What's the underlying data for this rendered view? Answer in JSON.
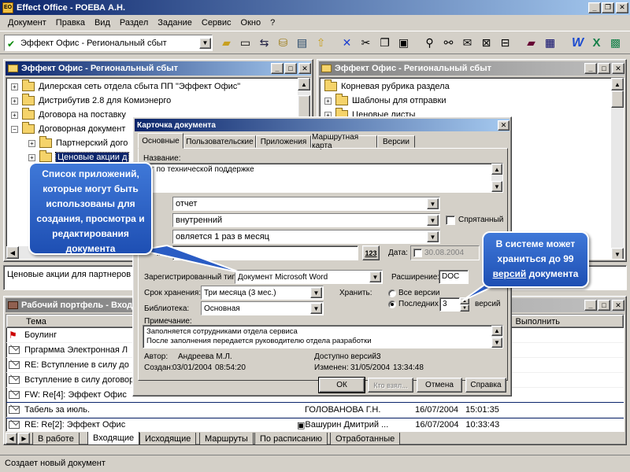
{
  "app": {
    "title": "Effect Office - РОЕВА А.Н.",
    "icon_label": "EO"
  },
  "menu": [
    "Документ",
    "Правка",
    "Вид",
    "Раздел",
    "Задание",
    "Сервис",
    "Окно",
    "?"
  ],
  "toolbar": {
    "combo_value": "Эффект Офис - Региональный сбыт"
  },
  "left_panel": {
    "title": "Эффект Офис - Региональный сбыт",
    "items": [
      {
        "label": "Дилерская сеть отдела сбыта ПП \"Эффект Офис\"",
        "level": 0
      },
      {
        "label": "Дистрибутив 2.8 для Комиэнерго",
        "level": 0
      },
      {
        "label": "Договора на поставку",
        "level": 0
      },
      {
        "label": "Договорная документ",
        "level": 0,
        "open": true
      },
      {
        "label": "Партнерский дого",
        "level": 1
      },
      {
        "label": "Ценовые акции д",
        "level": 1,
        "selected": true
      }
    ],
    "status": "Ценовые акции для партнеров"
  },
  "right_panel": {
    "title": "Эффект Офис - Региональный сбыт",
    "root": "Корневая рубрика раздела",
    "items": [
      "Шаблоны для отправки",
      "Ценовые листы"
    ]
  },
  "portfolio": {
    "title": "Рабочий портфель - Вход",
    "col_subject": "Тема",
    "col_perform": "Выполнить",
    "rows": [
      {
        "subject": "Боулинг",
        "author": "",
        "date": "",
        "time": "",
        "icon": "flag"
      },
      {
        "subject": "Пргармма Электронная Л",
        "author": "",
        "date": "",
        "time": "",
        "icon": "mail"
      },
      {
        "subject": "RE: Вступление в силу до",
        "author": "",
        "date": "",
        "time": "",
        "icon": "mail"
      },
      {
        "subject": "Вступление в силу договор",
        "author": "",
        "date": "",
        "time": "",
        "icon": "mail"
      },
      {
        "subject": "FW: Re[4]: Эффект Офис",
        "author": "",
        "date": "",
        "time": "",
        "icon": "mail"
      },
      {
        "subject": "Табель за июль.",
        "author": "ГОЛОВАНОВА Г.Н.",
        "date": "16/07/2004",
        "time": "15:01:35",
        "icon": "mail"
      },
      {
        "subject": "RE: Re[2]: Эффект Офис",
        "author": "Вашурин Дмитрий ...",
        "date": "16/07/2004",
        "time": "10:33:43",
        "icon": "mail"
      }
    ],
    "tabs": [
      "В работе",
      "Входящие",
      "Исходящие",
      "Маршруты",
      "По расписанию",
      "Отработанные"
    ]
  },
  "status_bar": "Создает новый документ",
  "dialog": {
    "title": "Карточка документа",
    "tabs": [
      "Основные",
      "Пользовательские",
      "Приложения",
      "Маршрутная карта",
      "Версии"
    ],
    "name_label": "Название:",
    "name_value": "ет по технической поддержке",
    "type_value": "отчет",
    "scope_value": "внутренний",
    "hidden_label": "Спрятанный",
    "period_value": "овляется 1 раз в месяц",
    "number_label": "мер:",
    "date_label": "Дата:",
    "date_value": "30.08.2004",
    "num_btn": "123",
    "reg_type_label": "Зарегистрированный тип:",
    "reg_type_value": "Документ Microsoft Word",
    "ext_label": "Расширение:",
    "ext_value": "DOC",
    "storage_label": "Срок хранения:",
    "storage_value": "Три месяца (3 мес.)",
    "library_label": "Библиотека:",
    "library_value": "Основная",
    "keep_label": "Хранить:",
    "all_versions": "Все версии",
    "last_label": "Последних",
    "last_value": "3",
    "versions_word": "версий",
    "note_label": "Примечание:",
    "note_lines": [
      "Заполняется сотрудниками отдела сервиса",
      "После заполнения передается руководителю отдела разработки"
    ],
    "author_label": "Автор:",
    "author_value": "Андреева М.Л.",
    "created_label": "Создан:",
    "created_date": "03/01/2004",
    "created_time": "08:54:20",
    "avail_label": "Доступно версий:",
    "avail_value": "3",
    "modified_label": "Изменен:",
    "modified_date": "31/05/2004",
    "modified_time": "13:34:48",
    "ok": "ОК",
    "who_took": "Кто взял...",
    "cancel": "Отмена",
    "help": "Справка"
  },
  "callout_left": "Список приложений, которые могут быть использованы для создания, просмотра и редактирования документа",
  "callout_right_a": "В системе может храниться до 99 ",
  "callout_right_b": "версий",
  "callout_right_c": " документа"
}
